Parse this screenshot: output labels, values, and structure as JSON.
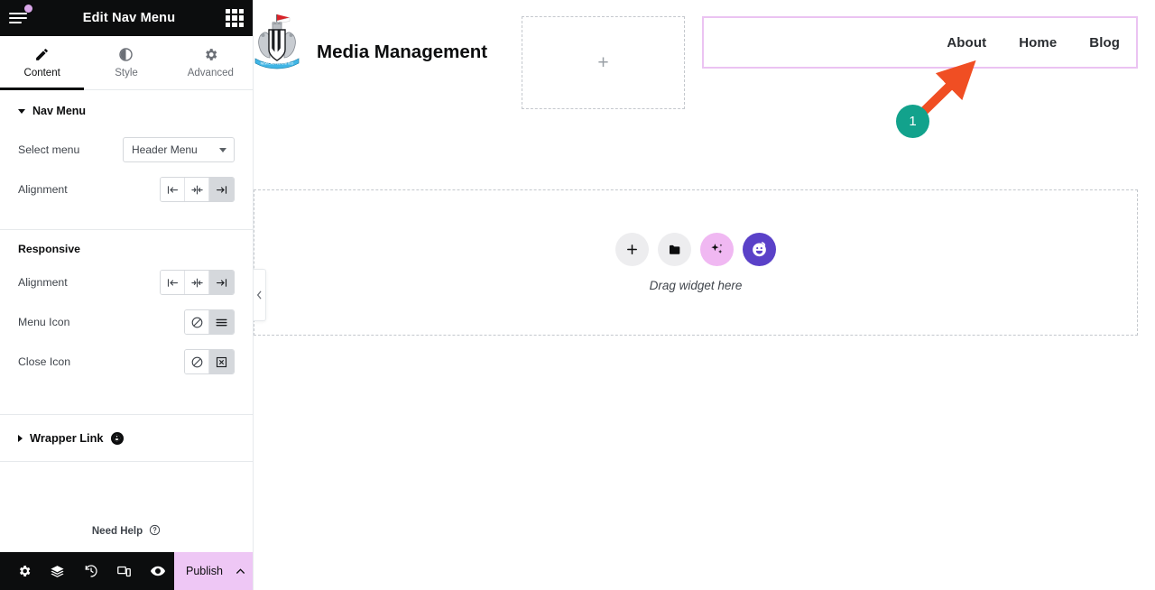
{
  "panel": {
    "header": {
      "title": "Edit Nav Menu",
      "menu_icon": "hamburger-menu-icon",
      "apps_icon": "apps-grid-icon",
      "notification_dot_color": "#d9a6e8"
    },
    "tabs": [
      {
        "label": "Content",
        "icon": "pencil-icon",
        "active": true
      },
      {
        "label": "Style",
        "icon": "contrast-circle-icon",
        "active": false
      },
      {
        "label": "Advanced",
        "icon": "gear-icon",
        "active": false
      }
    ],
    "sections": {
      "nav_menu": {
        "title": "Nav Menu",
        "expanded": true,
        "select_menu": {
          "label": "Select menu",
          "value": "Header Menu",
          "options": [
            "Header Menu"
          ]
        },
        "alignment": {
          "label": "Alignment",
          "options": [
            "align-left",
            "align-center",
            "align-right"
          ],
          "selected": "align-right"
        }
      },
      "responsive": {
        "title": "Responsive",
        "alignment": {
          "label": "Alignment",
          "options": [
            "align-left",
            "align-center",
            "align-right"
          ],
          "selected": "align-right"
        },
        "menu_icon": {
          "label": "Menu Icon",
          "options": [
            "none",
            "hamburger"
          ],
          "selected": "hamburger"
        },
        "close_icon": {
          "label": "Close Icon",
          "options": [
            "none",
            "x-box"
          ],
          "selected": "x-box"
        }
      },
      "wrapper_link": {
        "title": "Wrapper Link",
        "expanded": false,
        "badge": "pro-badge-icon"
      }
    },
    "need_help": {
      "label": "Need Help",
      "icon": "question-circle-icon"
    },
    "footer": {
      "icons": [
        "settings-gear-icon",
        "navigator-layers-icon",
        "history-icon",
        "responsive-mode-icon",
        "preview-eye-icon"
      ],
      "publish": {
        "label": "Publish",
        "caret": "chevron-up-icon",
        "color": "#eec7f5"
      }
    }
  },
  "canvas": {
    "logo": {
      "name": "site-crest-logo"
    },
    "site_title": "Media Management",
    "empty_slot": {
      "icon": "plus-icon"
    },
    "nav_widget": {
      "selected": true,
      "border_color": "#ebc3f2",
      "items": [
        "About",
        "Home",
        "Blog"
      ]
    },
    "drop_zone": {
      "text": "Drag widget here",
      "buttons": [
        {
          "name": "add-element-button",
          "icon": "plus-icon",
          "color": "#ededef"
        },
        {
          "name": "add-template-button",
          "icon": "folder-icon",
          "color": "#ededef"
        },
        {
          "name": "ai-generate-button",
          "icon": "sparkles-icon",
          "color": "#f0b8f2"
        },
        {
          "name": "add-widget-emoji-button",
          "icon": "smiley-face-icon",
          "color": "#5a41c8"
        }
      ]
    },
    "collapse_handle": {
      "icon": "chevron-left-icon"
    }
  },
  "annotation": {
    "step_number": "1",
    "badge_color": "#12a28c",
    "arrow_color": "#f04e23",
    "arrow_points_to": "nav-menu-widget"
  }
}
